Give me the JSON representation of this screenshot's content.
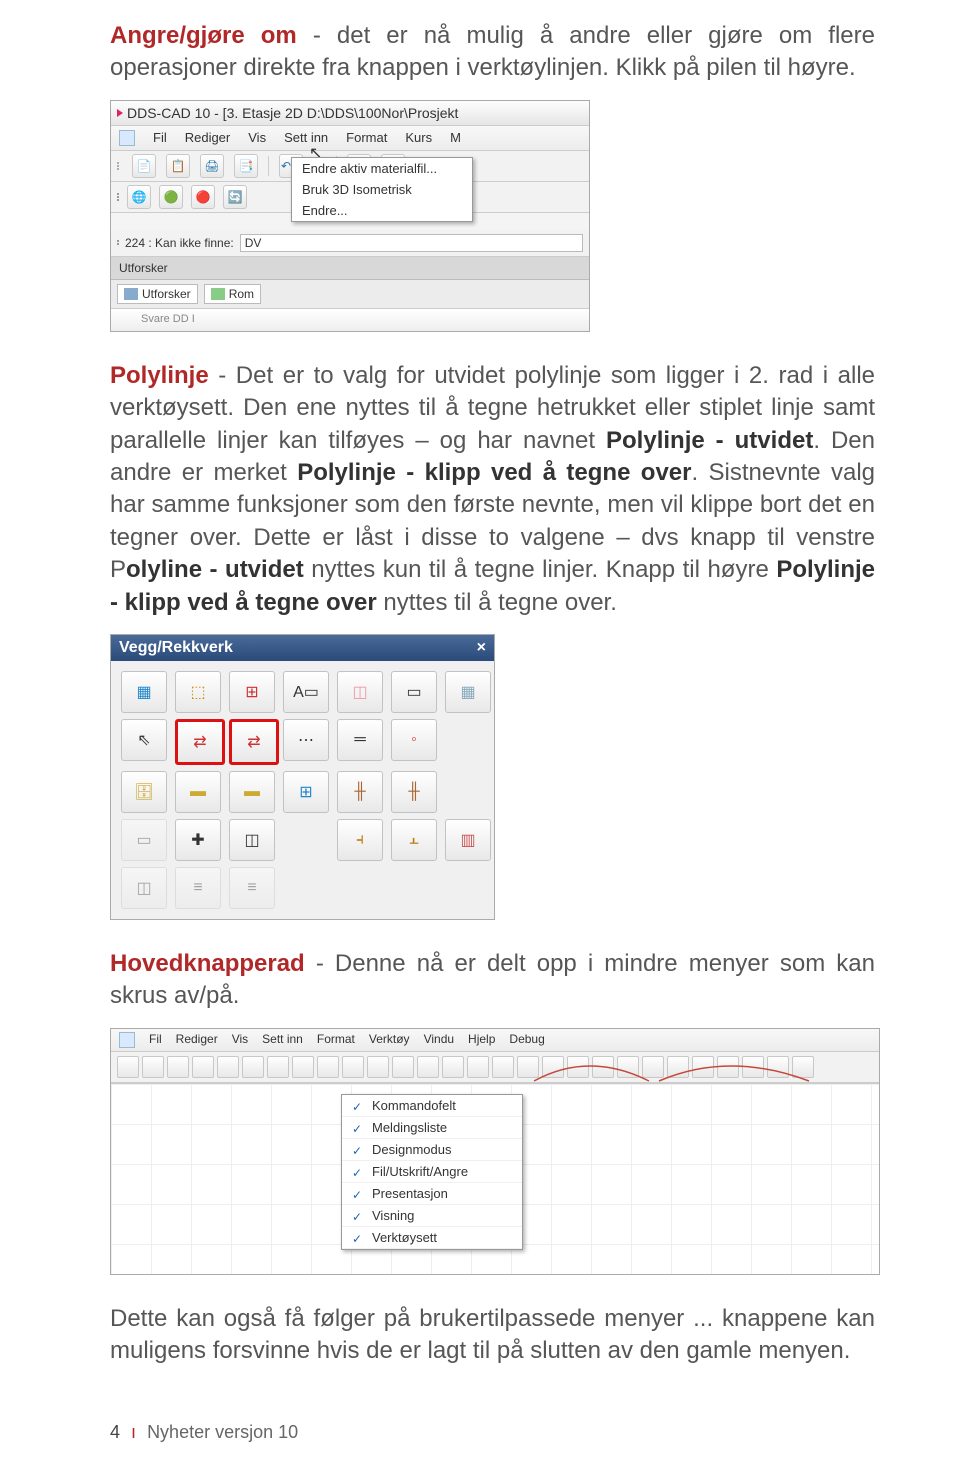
{
  "para1": {
    "term": "Angre/gjøre om",
    "rest": " - det er nå mulig å andre eller gjøre om flere operasjoner direkte fra knappen i verktøylinjen. Klikk på pilen til høyre."
  },
  "ss1": {
    "title": "DDS-CAD 10 - [3. Etasje  2D  D:\\DDS\\100Nor\\Prosjekt",
    "menu": [
      "Fil",
      "Rediger",
      "Vis",
      "Sett inn",
      "Format",
      "Kurs",
      "M"
    ],
    "dropdown": [
      "Endre aktiv materialfil...",
      "Bruk 3D Isometrisk",
      "Endre..."
    ],
    "status_prefix": "224 : Kan ikke finne:",
    "status_val": "DV",
    "utforsker": "Utforsker",
    "tab1": "Utforsker",
    "tab2": "Rom",
    "bottom": "Svare DD I"
  },
  "para2": {
    "term": "Polylinje",
    "seg1": " - Det er to valg for utvidet polylinje som ligger i 2. rad i alle verktøysett. Den ene nyttes til å tegne hetrukket eller stiplet linje samt parallelle linjer kan tilføyes – og har navnet ",
    "bold1": "Polylinje - utvidet",
    "seg2": ". Den andre er merket ",
    "bold2": "Polylinje - klipp ved å tegne over",
    "seg3": ". Sistnevnte valg har samme funksjoner som den første nevnte, men vil klippe bort det en tegner over. Dette er låst i disse to valgene – dvs knapp til venstre P",
    "bold3": "olyline - utvidet",
    "seg4": " nyttes kun til å tegne linjer. Knapp til høyre ",
    "bold4": "Polylinje - klipp ved å tegne over",
    "seg5": " nyttes til å tegne over."
  },
  "ss2": {
    "title": "Vegg/Rekkverk"
  },
  "para3": {
    "term": "Hovedknapperad",
    "rest": " - Denne nå er delt opp i mindre menyer som kan skrus av/på."
  },
  "ss3": {
    "menu": [
      "Fil",
      "Rediger",
      "Vis",
      "Sett inn",
      "Format",
      "Verktøy",
      "Vindu",
      "Hjelp",
      "Debug"
    ],
    "context": [
      "Kommandofelt",
      "Meldingsliste",
      "Designmodus",
      "Fil/Utskrift/Angre",
      "Presentasjon",
      "Visning",
      "Verktøysett"
    ]
  },
  "para4": "Dette kan også få følger på brukertilpassede menyer ... knappene kan muligens forsvinne hvis de er lagt til på slutten av den gamle menyen.",
  "footer": {
    "page": "4",
    "title": "Nyheter versjon 10"
  }
}
